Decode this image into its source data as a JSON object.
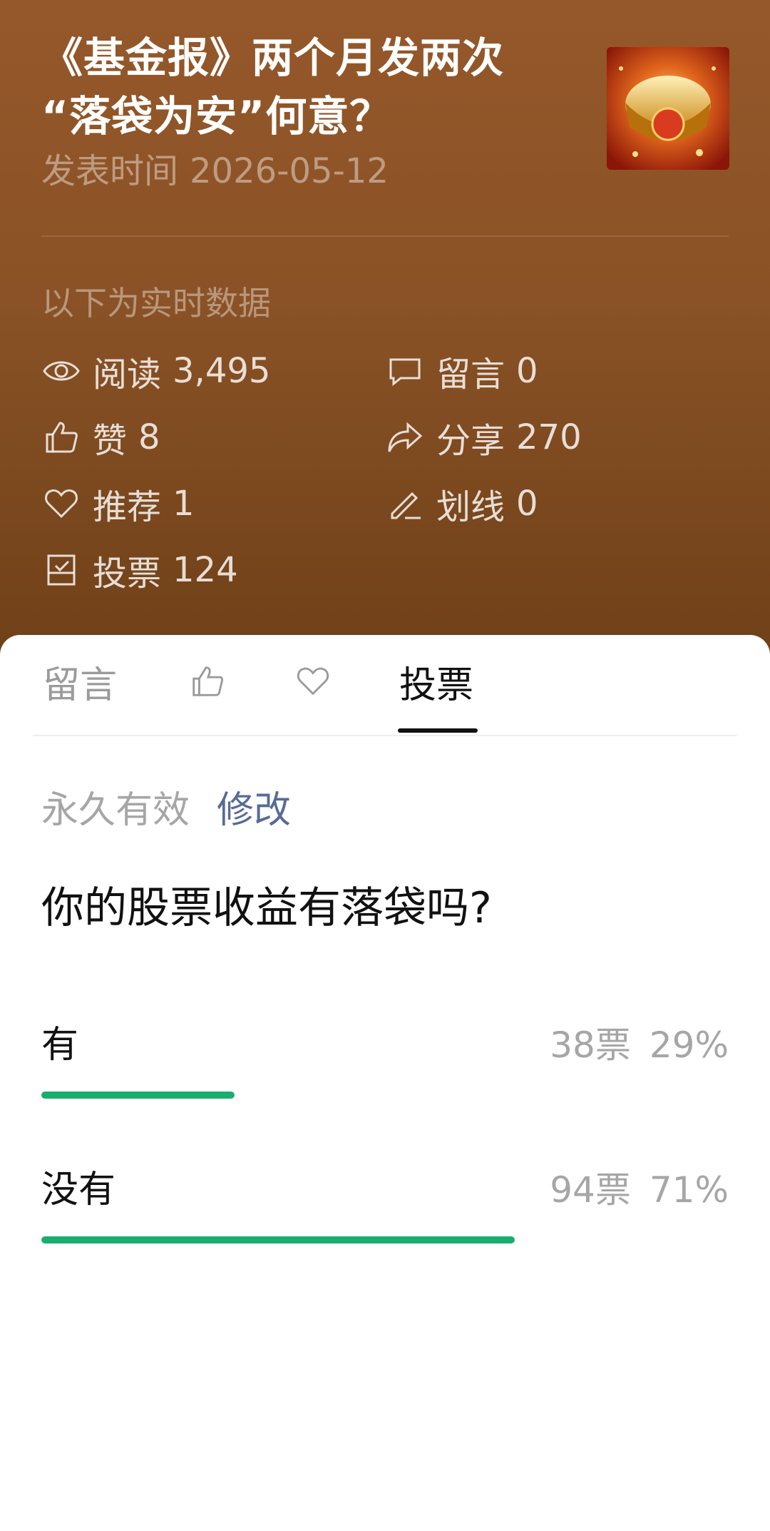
{
  "article": {
    "title_line1": "《基金报》两个月发两次",
    "title_line2": "“落袋为安”何意？",
    "publish_label": "发表时间",
    "publish_date": "2026-05-12"
  },
  "realtime_label": "以下为实时数据",
  "stats": {
    "read": {
      "label": "阅读",
      "value": "3,495",
      "icon": "eye-icon"
    },
    "comment": {
      "label": "留言",
      "value": "0",
      "icon": "comment-icon"
    },
    "like": {
      "label": "赞",
      "value": "8",
      "icon": "thumbs-up-icon"
    },
    "share": {
      "label": "分享",
      "value": "270",
      "icon": "share-icon"
    },
    "recommend": {
      "label": "推荐",
      "value": "1",
      "icon": "heart-icon"
    },
    "underline": {
      "label": "划线",
      "value": "0",
      "icon": "pencil-icon"
    },
    "vote": {
      "label": "投票",
      "value": "124",
      "icon": "ballot-icon"
    }
  },
  "tabs": {
    "comments": "留言",
    "vote": "投票",
    "active": "vote"
  },
  "poll": {
    "validity": "永久有效",
    "edit_label": "修改",
    "question": "你的股票收益有落袋吗?",
    "options": [
      {
        "label": "有",
        "votes": "38票",
        "percent": "29%",
        "fraction": 0.29
      },
      {
        "label": "没有",
        "votes": "94票",
        "percent": "71%",
        "fraction": 0.71
      }
    ],
    "bar_color": "#1aad6f"
  },
  "colors": {
    "header_bg": "#8a5226",
    "link": "#576b95"
  }
}
